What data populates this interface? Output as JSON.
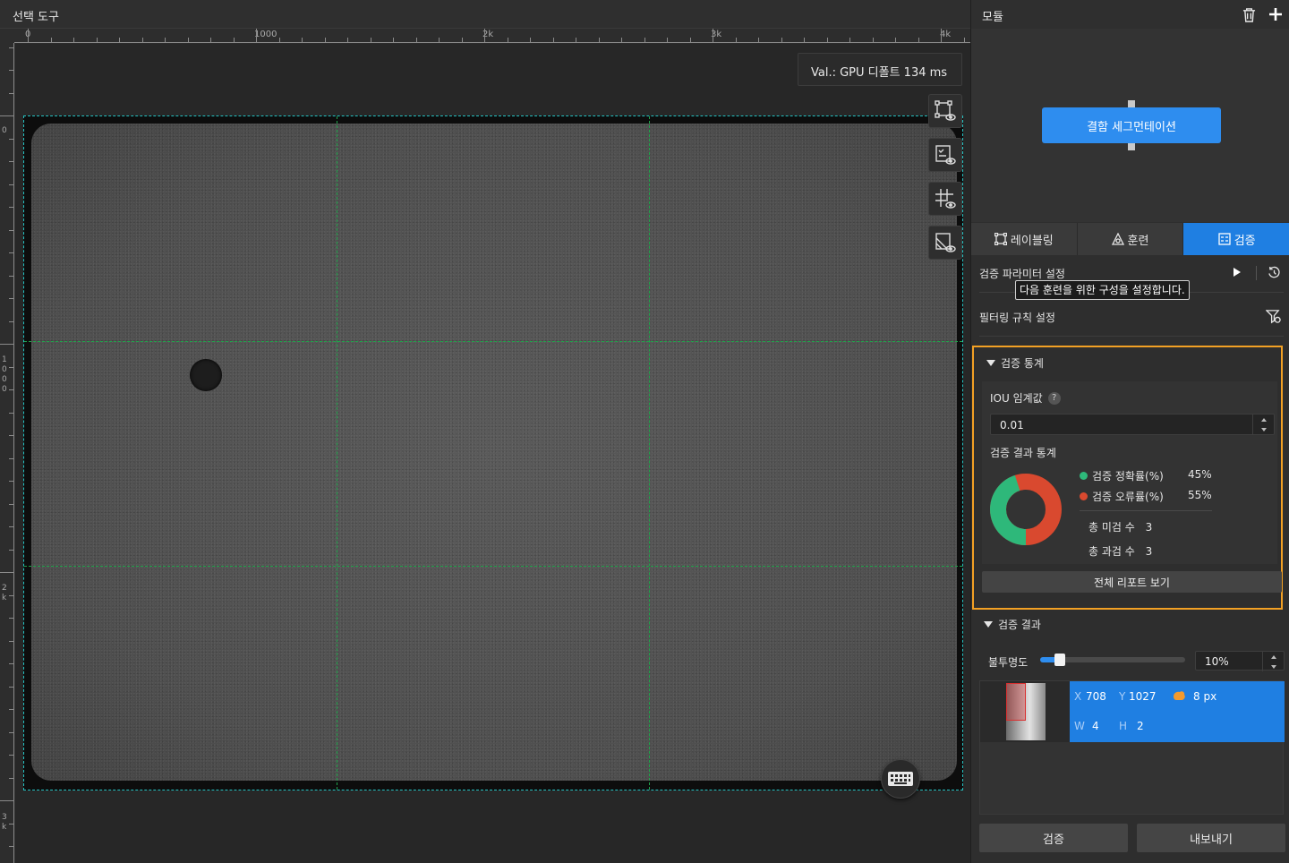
{
  "left_panel": {
    "title": "선택 도구",
    "ruler_top_labels": [
      "0",
      "1000",
      "2k",
      "3k",
      "4k"
    ],
    "ruler_left_labels": [
      "0",
      "1000",
      "2k",
      "3k"
    ],
    "val_badge": "Val.:  GPU 디폴트 134 ms",
    "side_tools": [
      "roi-view-icon",
      "label-view-icon",
      "grid-view-icon",
      "mask-view-icon"
    ],
    "keyboard_icon": "keyboard-icon"
  },
  "right_panel": {
    "title": "모듈",
    "delete_icon": "trash-icon",
    "add_icon": "plus-icon",
    "module_button": "결함 세그먼테이션",
    "tabs": [
      {
        "label": "레이블링",
        "icon": "labeling-icon"
      },
      {
        "label": "훈련",
        "icon": "training-icon"
      },
      {
        "label": "검증",
        "icon": "validation-icon",
        "active": true
      }
    ],
    "param_settings_label": "검증 파라미터 설정",
    "tooltip": "다음 훈련을 위한 구성을 설정합니다.",
    "filter_rule_label": "필터링 규칙 설정",
    "stats": {
      "header": "검증 통계",
      "iou_label": "IOU 임계값",
      "iou_help": "?",
      "iou_value": "0.01",
      "result_stats_label": "검증 결과 통계",
      "accuracy_label": "검증 정확률(%)",
      "accuracy_value": "45%",
      "error_label": "검증 오류률(%)",
      "error_value": "55%",
      "missed_label": "총 미검 수",
      "missed_value": "3",
      "over_label": "총 과검 수",
      "over_value": "3",
      "report_button": "전체 리포트 보기",
      "accuracy_fraction": 0.45,
      "colors": {
        "accuracy": "#2eb87a",
        "error": "#d9492f"
      }
    },
    "results": {
      "header": "검증 결과",
      "opacity_label": "불투명도",
      "opacity_value": "10%",
      "opacity_fraction": 0.1,
      "item": {
        "x_key": "X",
        "x_val": "708",
        "y_key": "Y",
        "y_val": "1027",
        "area_val": "8 px",
        "w_key": "W",
        "w_val": "4",
        "h_key": "H",
        "h_val": "2"
      }
    },
    "validate_button": "검증",
    "export_button": "내보내기"
  }
}
